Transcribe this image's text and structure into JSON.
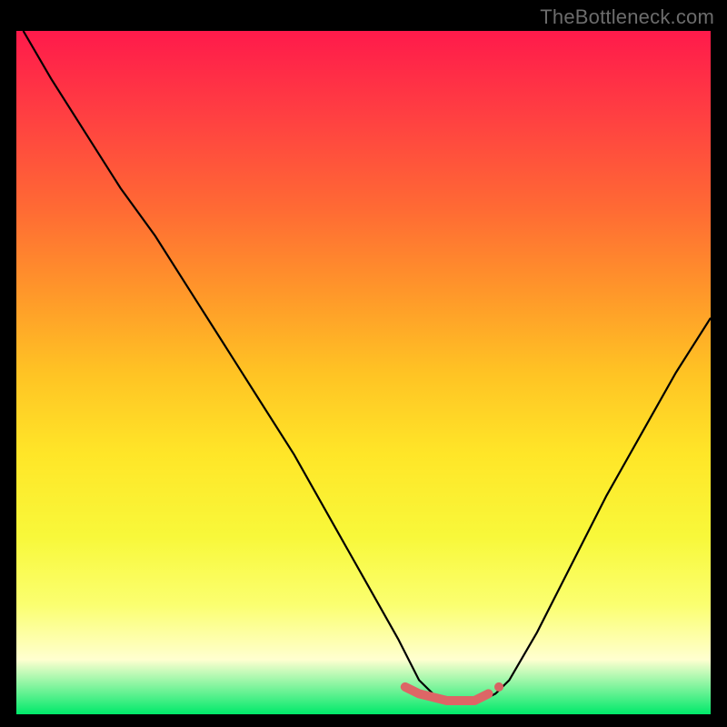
{
  "watermark": {
    "text": "TheBottleneck.com"
  },
  "chart_data": {
    "type": "line",
    "title": "",
    "xlabel": "",
    "ylabel": "",
    "xlim": [
      0,
      100
    ],
    "ylim": [
      0,
      100
    ],
    "grid": false,
    "legend": false,
    "series": [
      {
        "name": "bottleneck-curve",
        "color": "#000000",
        "x": [
          1,
          5,
          10,
          15,
          20,
          25,
          30,
          35,
          40,
          45,
          50,
          55,
          58,
          60,
          63,
          65,
          67,
          69,
          71,
          75,
          80,
          85,
          90,
          95,
          100
        ],
        "y": [
          100,
          93,
          85,
          77,
          70,
          62,
          54,
          46,
          38,
          29,
          20,
          11,
          5,
          3,
          2,
          2,
          2,
          3,
          5,
          12,
          22,
          32,
          41,
          50,
          58
        ]
      },
      {
        "name": "trough-marker",
        "color": "#dd6666",
        "x": [
          56,
          58,
          60,
          62,
          64,
          66,
          68,
          70
        ],
        "y": [
          4,
          3,
          2.5,
          2,
          2,
          2,
          3,
          4.5
        ]
      }
    ]
  }
}
